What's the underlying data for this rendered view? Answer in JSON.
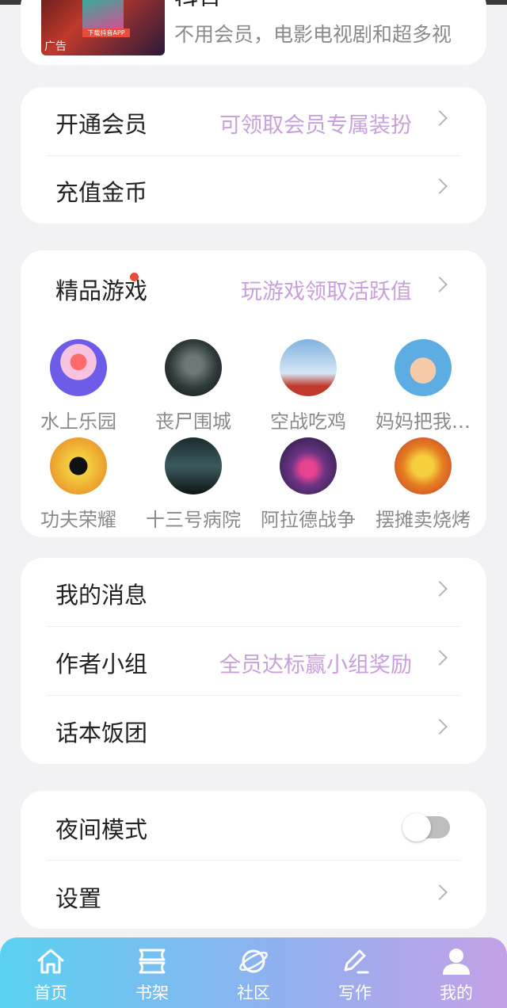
{
  "ad": {
    "title": "抖音",
    "description": "不用会员，电影电视剧和超多视",
    "tag": "广告",
    "poster_label": "下载抖音APP"
  },
  "membership": {
    "open_vip": {
      "label": "开通会员",
      "hint": "可领取会员专属装扮"
    },
    "recharge": {
      "label": "充值金币"
    }
  },
  "games": {
    "label": "精品游戏",
    "hint": "玩游戏领取活跃值",
    "items": [
      {
        "name": "水上乐园",
        "icon": "water-park-icon"
      },
      {
        "name": "丧尸围城",
        "icon": "zombie-icon"
      },
      {
        "name": "空战吃鸡",
        "icon": "air-battle-icon"
      },
      {
        "name": "妈妈把我…",
        "icon": "mom-game-icon"
      },
      {
        "name": "功夫荣耀",
        "icon": "kungfu-icon"
      },
      {
        "name": "十三号病院",
        "icon": "hospital-icon"
      },
      {
        "name": "阿拉德战争",
        "icon": "arad-war-icon"
      },
      {
        "name": "摆摊卖烧烤",
        "icon": "bbq-icon"
      }
    ]
  },
  "social": {
    "messages": {
      "label": "我的消息"
    },
    "author_group": {
      "label": "作者小组",
      "hint": "全员达标赢小组奖励"
    },
    "fan_club": {
      "label": "话本饭团"
    }
  },
  "settings": {
    "night_mode": {
      "label": "夜间模式",
      "enabled": false
    },
    "settings": {
      "label": "设置"
    }
  },
  "nav": {
    "tabs": [
      {
        "label": "首页",
        "icon": "home-icon"
      },
      {
        "label": "书架",
        "icon": "bookshelf-icon"
      },
      {
        "label": "社区",
        "icon": "planet-icon"
      },
      {
        "label": "写作",
        "icon": "pen-icon"
      },
      {
        "label": "我的",
        "icon": "user-icon",
        "active": true
      }
    ]
  },
  "colors": {
    "accent_hint": "#c9a0dc",
    "nav_start": "#5ad1f1",
    "nav_end": "#c4a1e7"
  }
}
